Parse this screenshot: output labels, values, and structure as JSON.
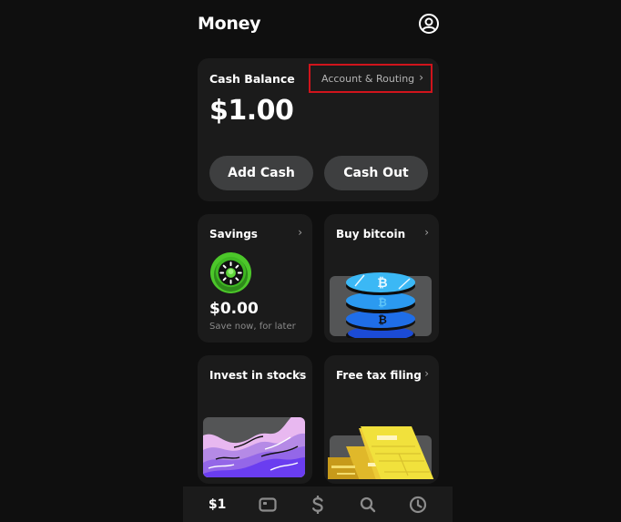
{
  "header": {
    "title": "Money",
    "profile_icon": "profile-icon"
  },
  "balance": {
    "label": "Cash Balance",
    "account_link": "Account & Routing",
    "account_chevron": "›",
    "amount": "$1.00",
    "add_cash_label": "Add Cash",
    "cash_out_label": "Cash Out",
    "highlight_color": "#d0141c"
  },
  "tiles": [
    {
      "id": "savings",
      "title": "Savings",
      "chevron": "›",
      "amount": "$0.00",
      "subtitle": "Save now, for later",
      "icon": "savings-sun-icon",
      "accent": "#4cc72a"
    },
    {
      "id": "bitcoin",
      "title": "Buy bitcoin",
      "chevron": "›",
      "art": "bitcoin-coins-illustration",
      "accent": "#1fa3f0"
    },
    {
      "id": "stocks",
      "title": "Invest in stocks",
      "chevron": "›",
      "art": "stocks-waves-illustration",
      "accent": "#7a4ff0"
    },
    {
      "id": "tax",
      "title": "Free tax filing",
      "chevron": "›",
      "art": "tax-forms-illustration",
      "accent": "#f1e13c"
    }
  ],
  "tabbar": {
    "items": [
      {
        "id": "money",
        "label": "$1",
        "icon": "money-tab",
        "active": true
      },
      {
        "id": "card",
        "icon": "card-icon"
      },
      {
        "id": "pay",
        "icon": "dollar-icon"
      },
      {
        "id": "search",
        "icon": "search-icon"
      },
      {
        "id": "activity",
        "icon": "clock-icon"
      }
    ]
  }
}
